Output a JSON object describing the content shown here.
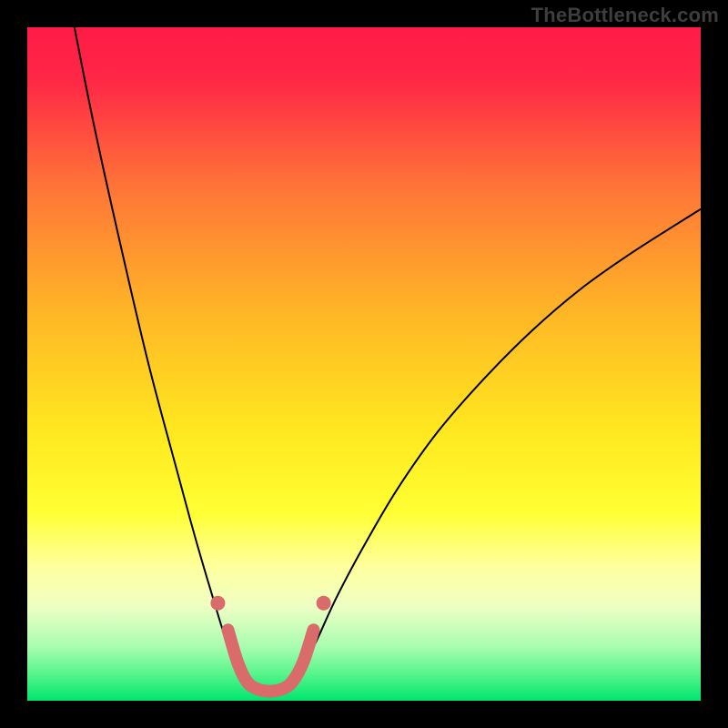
{
  "watermark": "TheBottleneck.com",
  "chart_data": {
    "type": "line",
    "title": "",
    "xlabel": "",
    "ylabel": "",
    "xlim": [
      0,
      100
    ],
    "ylim": [
      0,
      100
    ],
    "background": {
      "gradient_stops": [
        {
          "offset": 0.0,
          "color": "#ff1b47"
        },
        {
          "offset": 0.08,
          "color": "#ff2846"
        },
        {
          "offset": 0.24,
          "color": "#ff7637"
        },
        {
          "offset": 0.44,
          "color": "#ffbb25"
        },
        {
          "offset": 0.6,
          "color": "#ffe81f"
        },
        {
          "offset": 0.72,
          "color": "#ffff33"
        },
        {
          "offset": 0.8,
          "color": "#ffff9d"
        },
        {
          "offset": 0.86,
          "color": "#eeffc4"
        },
        {
          "offset": 0.92,
          "color": "#a8fdb0"
        },
        {
          "offset": 0.96,
          "color": "#57f58b"
        },
        {
          "offset": 1.0,
          "color": "#00e56f"
        }
      ]
    },
    "series": [
      {
        "name": "bottleneck-curve",
        "color": "#000000",
        "stroke_width": 2.0,
        "points": [
          {
            "x": 7.0,
            "y": 100.0
          },
          {
            "x": 10.0,
            "y": 85.0
          },
          {
            "x": 14.0,
            "y": 67.0
          },
          {
            "x": 18.0,
            "y": 50.0
          },
          {
            "x": 22.0,
            "y": 35.0
          },
          {
            "x": 25.0,
            "y": 24.0
          },
          {
            "x": 27.5,
            "y": 15.5
          },
          {
            "x": 29.5,
            "y": 9.0
          },
          {
            "x": 31.0,
            "y": 5.0
          },
          {
            "x": 32.5,
            "y": 2.5
          },
          {
            "x": 34.0,
            "y": 1.3
          },
          {
            "x": 36.0,
            "y": 0.8
          },
          {
            "x": 38.0,
            "y": 1.3
          },
          {
            "x": 39.5,
            "y": 2.5
          },
          {
            "x": 41.0,
            "y": 5.0
          },
          {
            "x": 43.0,
            "y": 9.0
          },
          {
            "x": 46.0,
            "y": 15.5
          },
          {
            "x": 50.0,
            "y": 23.0
          },
          {
            "x": 55.0,
            "y": 31.5
          },
          {
            "x": 61.0,
            "y": 40.0
          },
          {
            "x": 68.0,
            "y": 48.0
          },
          {
            "x": 75.0,
            "y": 55.0
          },
          {
            "x": 82.0,
            "y": 61.0
          },
          {
            "x": 89.0,
            "y": 66.0
          },
          {
            "x": 96.0,
            "y": 70.5
          },
          {
            "x": 100.0,
            "y": 73.0
          }
        ]
      },
      {
        "name": "optimal-zone-marker",
        "color": "#d96b6b",
        "stroke_width": 14,
        "linecap": "round",
        "points": [
          {
            "x": 29.8,
            "y": 10.5
          },
          {
            "x": 31.2,
            "y": 5.8
          },
          {
            "x": 32.5,
            "y": 3.0
          },
          {
            "x": 34.0,
            "y": 1.8
          },
          {
            "x": 36.0,
            "y": 1.4
          },
          {
            "x": 38.0,
            "y": 1.8
          },
          {
            "x": 39.5,
            "y": 3.0
          },
          {
            "x": 41.0,
            "y": 5.8
          },
          {
            "x": 42.5,
            "y": 10.5
          }
        ]
      },
      {
        "name": "marker-dot-left",
        "color": "#d96b6b",
        "type_hint": "point",
        "points": [
          {
            "x": 28.3,
            "y": 14.5
          }
        ]
      },
      {
        "name": "marker-dot-right",
        "color": "#d96b6b",
        "type_hint": "point",
        "points": [
          {
            "x": 44.0,
            "y": 14.5
          }
        ]
      }
    ]
  }
}
